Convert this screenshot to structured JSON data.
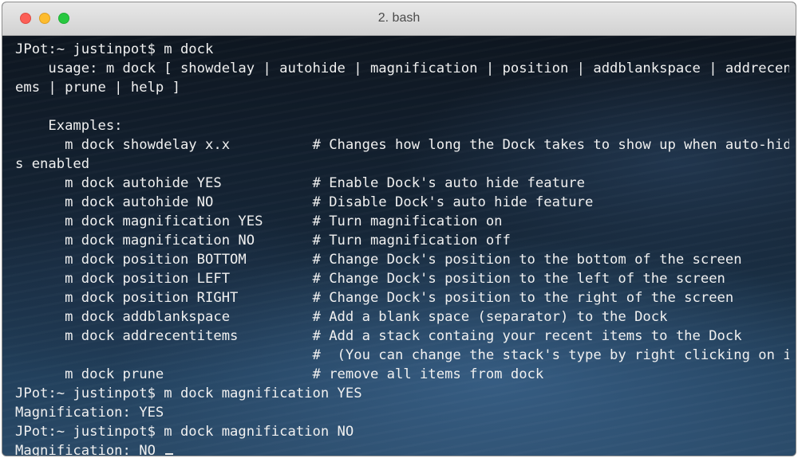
{
  "window": {
    "title": "2. bash"
  },
  "terminal": {
    "lines": [
      "JPot:~ justinpot$ m dock",
      "    usage: m dock [ showdelay | autohide | magnification | position | addblankspace | addrecentit",
      "ems | prune | help ]",
      "",
      "    Examples:",
      "      m dock showdelay x.x          # Changes how long the Dock takes to show up when auto-hide i",
      "s enabled",
      "      m dock autohide YES           # Enable Dock's auto hide feature",
      "      m dock autohide NO            # Disable Dock's auto hide feature",
      "      m dock magnification YES      # Turn magnification on",
      "      m dock magnification NO       # Turn magnification off",
      "      m dock position BOTTOM        # Change Dock's position to the bottom of the screen",
      "      m dock position LEFT          # Change Dock's position to the left of the screen",
      "      m dock position RIGHT         # Change Dock's position to the right of the screen",
      "      m dock addblankspace          # Add a blank space (separator) to the Dock",
      "      m dock addrecentitems         # Add a stack containg your recent items to the Dock",
      "                                    #  (You can change the stack's type by right clicking on it)",
      "      m dock prune                  # remove all items from dock",
      "JPot:~ justinpot$ m dock magnification YES",
      "Magnification: YES",
      "JPot:~ justinpot$ m dock magnification NO",
      "Magnification: NO "
    ]
  },
  "colors": {
    "text": "#f0f0f0",
    "titlebar": "#dcdcdc",
    "close": "#fc5f57",
    "minimize": "#fdbc2e",
    "zoom": "#28c840"
  }
}
